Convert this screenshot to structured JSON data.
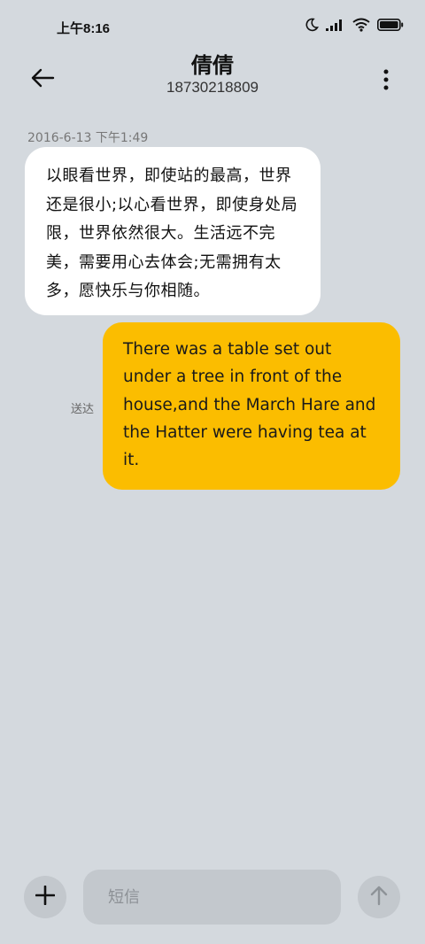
{
  "status_bar": {
    "time": "上午8:16"
  },
  "header": {
    "contact_name": "倩倩",
    "contact_number": "18730218809"
  },
  "conversation": {
    "timestamp": "2016-6-13 下午1:49",
    "incoming_message": "以眼看世界，即使站的最高，世界还是很小;以心看世界，即使身处局限，世界依然很大。生活远不完美，需要用心去体会;无需拥有太多，愿快乐与你相随。",
    "outgoing_message": "There was a table set out under a tree in front of the house,and the March Hare and the Hatter were having tea at it.",
    "delivery_status": "送达",
    "colors": {
      "incoming_bubble": "#ffffff",
      "outgoing_bubble": "#fbbd00",
      "background": "#d4d9de"
    }
  },
  "composer": {
    "placeholder": "短信",
    "icons": {
      "attach": "plus-icon",
      "send": "arrow-up-icon"
    }
  }
}
